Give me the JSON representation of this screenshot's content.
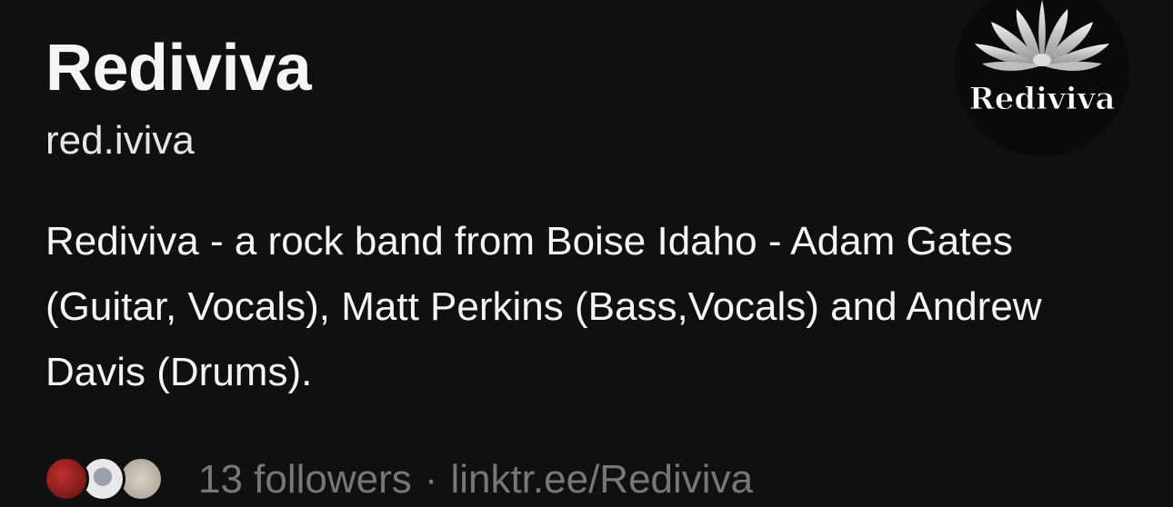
{
  "profile": {
    "name": "Rediviva",
    "handle": "red.iviva",
    "avatar_text": "Rediviva",
    "bio": "Rediviva - a rock band from Boise Idaho - Adam Gates (Guitar, Vocals), Matt Perkins (Bass,Vocals) and Andrew Davis (Drums).",
    "followers": "13 followers",
    "separator": "·",
    "link": "linktr.ee/Rediviva"
  },
  "colors": {
    "background": "#101010",
    "primary_text": "#f3f5f7",
    "secondary_text": "#777777"
  },
  "icons": {
    "avatar": "lotus-flower-logo",
    "follower_avatars": [
      "follower-avatar-1",
      "follower-avatar-2",
      "follower-avatar-3"
    ]
  }
}
